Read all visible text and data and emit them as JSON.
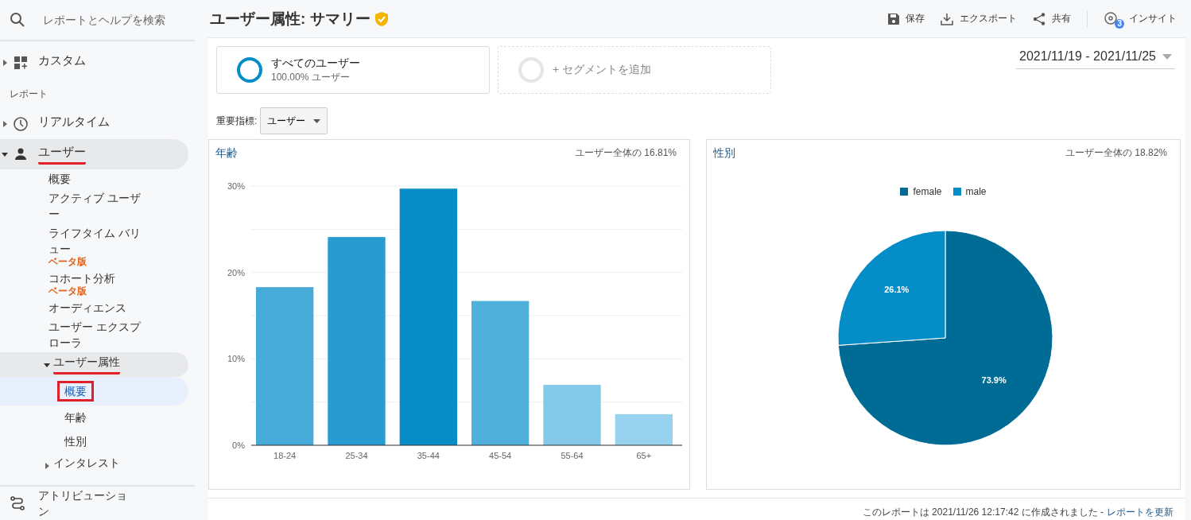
{
  "search": {
    "placeholder": "レポートとヘルプを検索"
  },
  "sidebar": {
    "top": [
      {
        "label": "カスタム",
        "expanded": false
      }
    ],
    "section_label": "レポート",
    "items": [
      {
        "label": "リアルタイム",
        "expanded": false,
        "selected": false
      },
      {
        "label": "ユーザー",
        "expanded": true,
        "selected": true,
        "underlined": true,
        "children": [
          {
            "label": "概要",
            "selected": false
          },
          {
            "label": "アクティブ ユーザー",
            "selected": false
          },
          {
            "label": "ライフタイム バリュー",
            "badge": "ベータ版",
            "selected": false
          },
          {
            "label": "コホート分析",
            "badge": "ベータ版",
            "selected": false
          },
          {
            "label": "オーディエンス",
            "selected": false
          },
          {
            "label": "ユーザー エクスプローラ",
            "selected": false
          },
          {
            "label": "ユーザー属性",
            "expanded": true,
            "selected": true,
            "underlined": true,
            "children": [
              {
                "label": "概要",
                "selected": true,
                "boxed": true
              },
              {
                "label": "年齢",
                "selected": false
              },
              {
                "label": "性別",
                "selected": false
              }
            ]
          },
          {
            "label": "インタレスト",
            "expanded": false,
            "selected": false
          }
        ]
      }
    ],
    "bottom": {
      "label": "アトリビューション"
    }
  },
  "header": {
    "title": "ユーザー属性: サマリー",
    "actions": [
      {
        "label": "保存"
      },
      {
        "label": "エクスポート"
      },
      {
        "label": "共有"
      },
      {
        "label": "インサイト",
        "badge": "3"
      }
    ]
  },
  "segments": [
    {
      "kind": "segment",
      "name": "すべてのユーザー",
      "detail": "100.00% ユーザー"
    },
    {
      "kind": "add",
      "name": "+ セグメントを追加"
    }
  ],
  "date_range": "2021/11/19 - 2021/11/25",
  "key_metric": {
    "label": "重要指標:",
    "value": "ユーザー"
  },
  "panels": [
    {
      "title": "年齢",
      "note": "ユーザー全体の 16.81%",
      "chart_data": {
        "type": "bar",
        "categories": [
          "18-24",
          "25-34",
          "35-44",
          "45-54",
          "55-64",
          "65+"
        ],
        "series": [
          {
            "colors": [
              "#47abda",
              "#289bd0",
              "#078cc6",
              "#50b0dc",
              "#84c9e8",
              "#97d3ee"
            ],
            "values": [
              18.3,
              24.1,
              29.7,
              16.7,
              7.0,
              3.6
            ]
          }
        ],
        "ylim": [
          0,
          30
        ],
        "yticks": [
          {
            "value": 0,
            "label": "0%"
          },
          {
            "value": 10,
            "label": "10%"
          },
          {
            "value": 20,
            "label": "20%"
          },
          {
            "value": 30,
            "label": "30%"
          }
        ]
      }
    },
    {
      "title": "性別",
      "note": "ユーザー全体の 18.82%",
      "chart_data": {
        "type": "pie",
        "categories": [
          "female",
          "male"
        ],
        "series": [
          {
            "colors": [
              "#006c96",
              "#058dc7"
            ],
            "values": [
              73.9,
              26.1
            ]
          }
        ],
        "value_labels": [
          "73.9%",
          "26.1%"
        ]
      }
    }
  ],
  "footer": {
    "text": "このレポートは 2021/11/26 12:17:42 に作成されました -",
    "link": "レポートを更新"
  }
}
